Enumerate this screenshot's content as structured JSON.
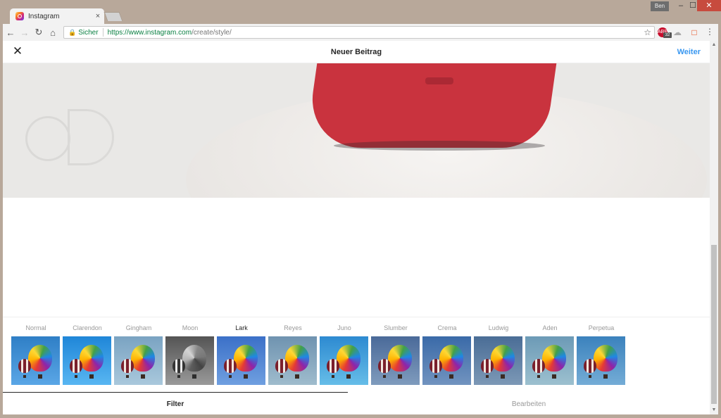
{
  "browser": {
    "tab_title": "Instagram",
    "tab_close": "×",
    "user_badge": "Ben",
    "secure_label": "Sicher",
    "url_host": "https://www.instagram.com",
    "url_path": "/create/style/",
    "adblock_count": "32"
  },
  "header": {
    "title": "Neuer Beitrag",
    "next_label": "Weiter"
  },
  "filters": [
    {
      "name": "Normal",
      "active": false
    },
    {
      "name": "Clarendon",
      "active": false
    },
    {
      "name": "Gingham",
      "active": false
    },
    {
      "name": "Moon",
      "active": false
    },
    {
      "name": "Lark",
      "active": true
    },
    {
      "name": "Reyes",
      "active": false
    },
    {
      "name": "Juno",
      "active": false
    },
    {
      "name": "Slumber",
      "active": false
    },
    {
      "name": "Crema",
      "active": false
    },
    {
      "name": "Ludwig",
      "active": false
    },
    {
      "name": "Aden",
      "active": false
    },
    {
      "name": "Perpetua",
      "active": false
    }
  ],
  "bottom_tabs": {
    "filter_label": "Filter",
    "edit_label": "Bearbeiten",
    "selected": "Filter"
  },
  "colors": {
    "link": "#3897f0",
    "text": "#262626",
    "muted": "#999999"
  }
}
